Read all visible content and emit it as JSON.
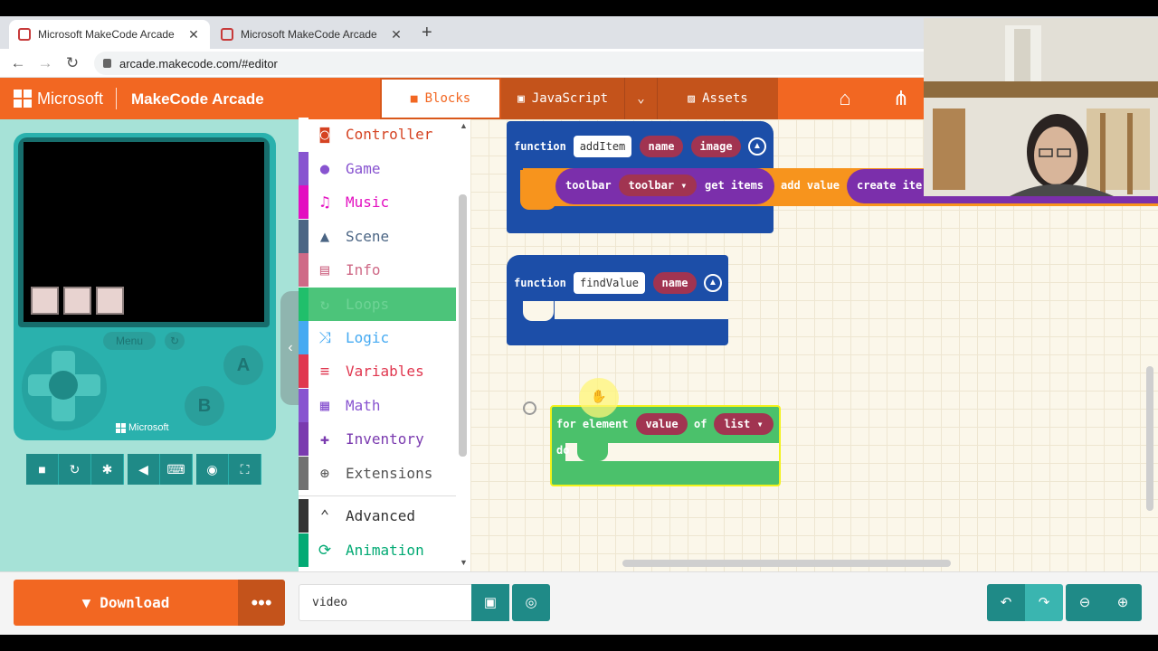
{
  "browser": {
    "tabs": [
      {
        "label": "Microsoft MakeCode Arcade",
        "active": true
      },
      {
        "label": "Microsoft MakeCode Arcade",
        "active": false
      }
    ],
    "url": "arcade.makecode.com/#editor"
  },
  "header": {
    "brand": "Microsoft",
    "app_name": "MakeCode Arcade",
    "tabs": [
      {
        "label": "Blocks",
        "icon": "puzzle-icon",
        "active": true
      },
      {
        "label": "JavaScript",
        "icon": "js-icon",
        "active": false
      },
      {
        "label": "Assets",
        "icon": "image-icon",
        "active": false
      }
    ],
    "icons": [
      "home-icon",
      "share-icon"
    ],
    "accent_color": "#f26722"
  },
  "simulator": {
    "menu_label": "Menu",
    "a_label": "A",
    "b_label": "B",
    "console_brand": "Microsoft",
    "buttons": [
      "stop-icon",
      "restart-icon",
      "debug-icon",
      "sound-icon",
      "keyboard-icon",
      "screenshot-icon",
      "fullscreen-icon"
    ]
  },
  "toolbox": {
    "categories": [
      {
        "label": "Controller",
        "color": "#d54322",
        "icon": "gamepad-icon"
      },
      {
        "label": "Game",
        "color": "#8854d0",
        "icon": "circle-icon"
      },
      {
        "label": "Music",
        "color": "#e30fc0",
        "icon": "headphones-icon"
      },
      {
        "label": "Scene",
        "color": "#4b6584",
        "icon": "tree-icon"
      },
      {
        "label": "Info",
        "color": "#cf6a87",
        "icon": "id-card-icon"
      },
      {
        "label": "Loops",
        "color": "#20bf6b",
        "icon": "refresh-icon"
      },
      {
        "label": "Logic",
        "color": "#45aaf2",
        "icon": "shuffle-icon"
      },
      {
        "label": "Variables",
        "color": "#e0374f",
        "icon": "list-icon"
      },
      {
        "label": "Math",
        "color": "#8854d0",
        "icon": "calculator-icon"
      },
      {
        "label": "Inventory",
        "color": "#7a3aaf",
        "icon": "puzzle-icon"
      },
      {
        "label": "Extensions",
        "color": "#717171",
        "icon": "plus-circle-icon"
      }
    ],
    "advanced_label": "Advanced",
    "animation_label": "Animation"
  },
  "workspace": {
    "block1": {
      "keyword": "function",
      "name": "addItem",
      "params": [
        "name",
        "image"
      ]
    },
    "block1_body": {
      "toolbar_label": "toolbar",
      "toolbar_var": "toolbar",
      "get_items": "get items",
      "add_value": "add value",
      "create_item": "create ite"
    },
    "block2": {
      "keyword": "function",
      "name": "findValue",
      "params": [
        "name"
      ]
    },
    "block3": {
      "for_element": "for element",
      "value": "value",
      "of": "of",
      "list": "list",
      "do": "do"
    },
    "colors": {
      "function": "#1c4ea8",
      "array": "#7b2fab",
      "variable": "#a13451",
      "loops": "#4bc16b",
      "arrays_orange": "#f7941d"
    }
  },
  "footer": {
    "download_label": "Download",
    "more_label": "•••",
    "project_name": "video"
  }
}
